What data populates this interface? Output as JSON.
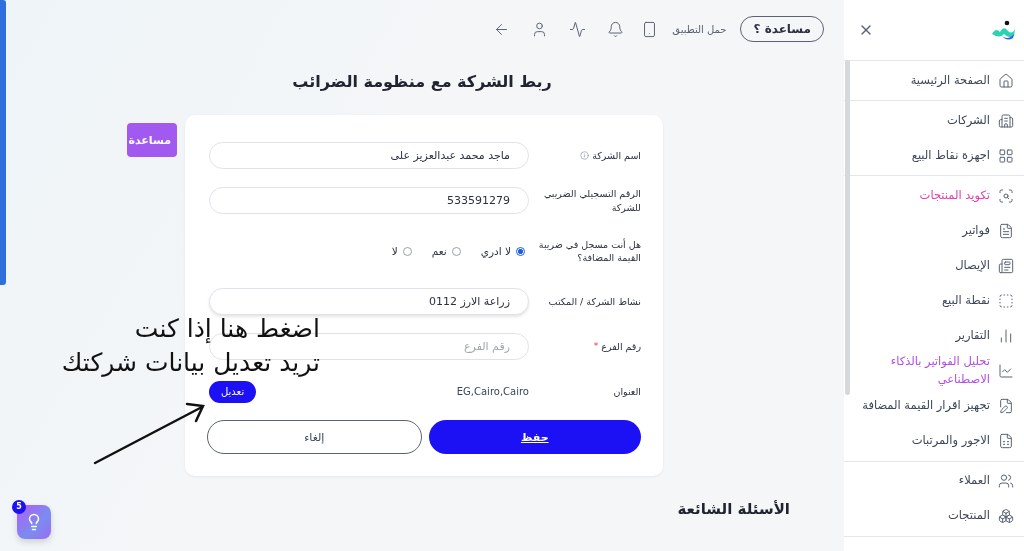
{
  "topbar": {
    "help_button": {
      "label": "مساعدة",
      "mark": "؟"
    },
    "app_download": {
      "label": "حمل التطبيق"
    }
  },
  "sidebar": {
    "groups": [
      [
        {
          "label": "الصفحة الرئيسية",
          "selected": false,
          "kind": "normal"
        }
      ],
      [
        {
          "label": "الشركات",
          "selected": false,
          "kind": "normal"
        },
        {
          "label": "اجهزة نقاط البيع",
          "selected": false,
          "kind": "normal"
        }
      ],
      [
        {
          "label": "تكويد المنتجات",
          "selected": true,
          "kind": "normal"
        },
        {
          "label": "فواتير",
          "selected": false,
          "kind": "normal"
        },
        {
          "label": "الإيصال",
          "selected": false,
          "kind": "normal"
        },
        {
          "label": "نقطة البيع",
          "selected": false,
          "kind": "normal"
        },
        {
          "label": "التقارير",
          "selected": false,
          "kind": "normal"
        },
        {
          "label": "تحليل الفواتير بالذكاء الاصطناعي",
          "selected": false,
          "kind": "ai"
        },
        {
          "label": "تجهيز اقرار القيمة المضافة",
          "selected": false,
          "kind": "normal"
        },
        {
          "label": "الاجور والمرتبات",
          "selected": false,
          "kind": "normal"
        }
      ],
      [
        {
          "label": "العملاء",
          "selected": false,
          "kind": "normal"
        },
        {
          "label": "المنتجات",
          "selected": false,
          "kind": "normal"
        }
      ]
    ]
  },
  "page_title": "ربط الشركة مع منظومة الضرائب",
  "side_help_tab": "مساعدة",
  "form": {
    "rows": [
      {
        "kind": "text",
        "label": "اسم الشركة",
        "info": true,
        "value": "ماجد محمد عبدالعزيز على"
      },
      {
        "kind": "text",
        "label": "الرقم التسجيلي الضريبي للشركة",
        "value": "533591279"
      },
      {
        "kind": "radio",
        "label": "هل أنت مسجل في ضريبة القيمة المضافة؟",
        "options": [
          {
            "label": "لا ادري",
            "selected": true
          },
          {
            "label": "نعم",
            "selected": false
          },
          {
            "label": "لا",
            "selected": false
          }
        ]
      },
      {
        "kind": "text",
        "label": "نشاط الشركة / المكتب",
        "value": "زراعة الارز 0112"
      },
      {
        "kind": "text",
        "label": "رقم الفرع",
        "required_mark": "*",
        "placeholder": "رقم الفرع"
      },
      {
        "kind": "address",
        "label": "العنوان",
        "value": "EG,Cairo,Cairo",
        "button": "تعديل"
      }
    ],
    "save_button": "حفظ",
    "cancel_button": "إلغاء"
  },
  "annotation": {
    "lines": [
      "اضغط هنا إذا كنت",
      "تريد تعديل بيانات شركتك"
    ]
  },
  "faq_heading": "الأسئلة الشائعة",
  "tips_badge": "5"
}
